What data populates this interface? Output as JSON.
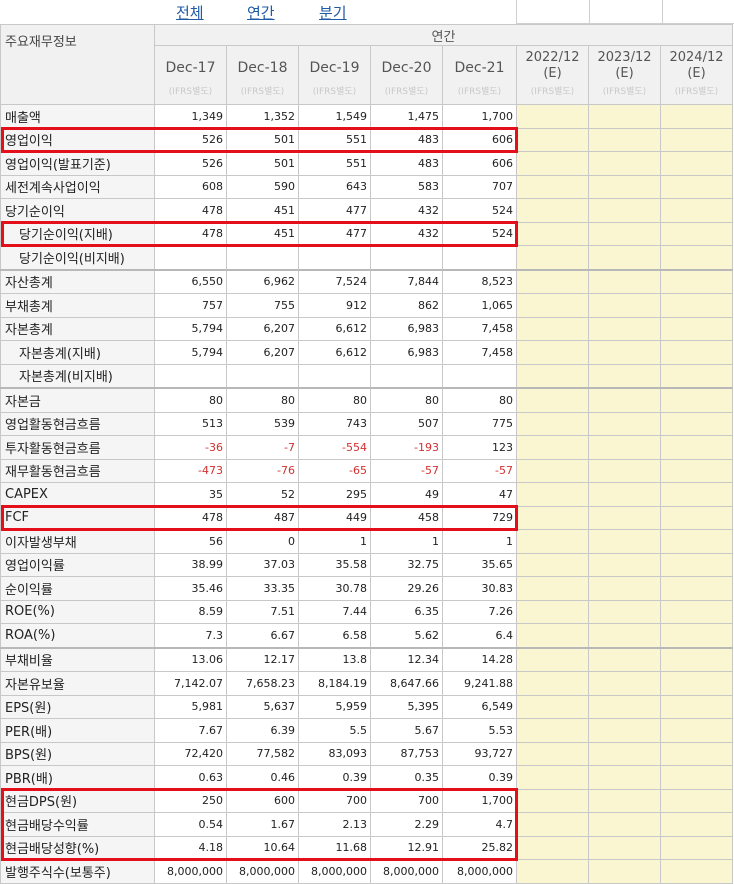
{
  "tabs": {
    "all": "전체",
    "annual": "연간",
    "quarter": "분기"
  },
  "header": {
    "label": "주요재무정보",
    "group": "연간",
    "periods": [
      "Dec-17",
      "Dec-18",
      "Dec-19",
      "Dec-20",
      "Dec-21"
    ],
    "estimates": [
      {
        "year": "2022/12",
        "tag": "(E)"
      },
      {
        "year": "2023/12",
        "tag": "(E)"
      },
      {
        "year": "2024/12",
        "tag": "(E)"
      }
    ],
    "ifrs": "(IFRS별도)"
  },
  "rows": [
    {
      "label": "매출액",
      "values": [
        "1,349",
        "1,352",
        "1,549",
        "1,475",
        "1,700"
      ]
    },
    {
      "label": "영업이익",
      "values": [
        "526",
        "501",
        "551",
        "483",
        "606"
      ]
    },
    {
      "label": "영업이익(발표기준)",
      "values": [
        "526",
        "501",
        "551",
        "483",
        "606"
      ]
    },
    {
      "label": "세전계속사업이익",
      "values": [
        "608",
        "590",
        "643",
        "583",
        "707"
      ]
    },
    {
      "label": "당기순이익",
      "values": [
        "478",
        "451",
        "477",
        "432",
        "524"
      ]
    },
    {
      "label": "당기순이익(지배)",
      "indent": true,
      "values": [
        "478",
        "451",
        "477",
        "432",
        "524"
      ]
    },
    {
      "label": "당기순이익(비지배)",
      "indent": true,
      "values": [
        "",
        "",
        "",
        "",
        ""
      ]
    },
    {
      "label": "자산총계",
      "values": [
        "6,550",
        "6,962",
        "7,524",
        "7,844",
        "8,523"
      ]
    },
    {
      "label": "부채총계",
      "values": [
        "757",
        "755",
        "912",
        "862",
        "1,065"
      ]
    },
    {
      "label": "자본총계",
      "values": [
        "5,794",
        "6,207",
        "6,612",
        "6,983",
        "7,458"
      ]
    },
    {
      "label": "자본총계(지배)",
      "indent": true,
      "values": [
        "5,794",
        "6,207",
        "6,612",
        "6,983",
        "7,458"
      ]
    },
    {
      "label": "자본총계(비지배)",
      "indent": true,
      "values": [
        "",
        "",
        "",
        "",
        ""
      ]
    },
    {
      "label": "자본금",
      "values": [
        "80",
        "80",
        "80",
        "80",
        "80"
      ]
    },
    {
      "label": "영업활동현금흐름",
      "values": [
        "513",
        "539",
        "743",
        "507",
        "775"
      ]
    },
    {
      "label": "투자활동현금흐름",
      "values": [
        "-36",
        "-7",
        "-554",
        "-193",
        "123"
      ]
    },
    {
      "label": "재무활동현금흐름",
      "values": [
        "-473",
        "-76",
        "-65",
        "-57",
        "-57"
      ]
    },
    {
      "label": "CAPEX",
      "values": [
        "35",
        "52",
        "295",
        "49",
        "47"
      ]
    },
    {
      "label": "FCF",
      "values": [
        "478",
        "487",
        "449",
        "458",
        "729"
      ]
    },
    {
      "label": "이자발생부채",
      "values": [
        "56",
        "0",
        "1",
        "1",
        "1"
      ]
    },
    {
      "label": "영업이익률",
      "values": [
        "38.99",
        "37.03",
        "35.58",
        "32.75",
        "35.65"
      ]
    },
    {
      "label": "순이익률",
      "values": [
        "35.46",
        "33.35",
        "30.78",
        "29.26",
        "30.83"
      ]
    },
    {
      "label": "ROE(%)",
      "values": [
        "8.59",
        "7.51",
        "7.44",
        "6.35",
        "7.26"
      ]
    },
    {
      "label": "ROA(%)",
      "values": [
        "7.3",
        "6.67",
        "6.58",
        "5.62",
        "6.4"
      ]
    },
    {
      "label": "부채비율",
      "values": [
        "13.06",
        "12.17",
        "13.8",
        "12.34",
        "14.28"
      ]
    },
    {
      "label": "자본유보율",
      "values": [
        "7,142.07",
        "7,658.23",
        "8,184.19",
        "8,647.66",
        "9,241.88"
      ]
    },
    {
      "label": "EPS(원)",
      "values": [
        "5,981",
        "5,637",
        "5,959",
        "5,395",
        "6,549"
      ]
    },
    {
      "label": "PER(배)",
      "values": [
        "7.67",
        "6.39",
        "5.5",
        "5.67",
        "5.53"
      ]
    },
    {
      "label": "BPS(원)",
      "values": [
        "72,420",
        "77,582",
        "83,093",
        "87,753",
        "93,727"
      ]
    },
    {
      "label": "PBR(배)",
      "values": [
        "0.63",
        "0.46",
        "0.39",
        "0.35",
        "0.39"
      ]
    },
    {
      "label": "현금DPS(원)",
      "values": [
        "250",
        "600",
        "700",
        "700",
        "1,700"
      ]
    },
    {
      "label": "현금배당수익률",
      "values": [
        "0.54",
        "1.67",
        "2.13",
        "2.29",
        "4.7"
      ]
    },
    {
      "label": "현금배당성향(%)",
      "values": [
        "4.18",
        "10.64",
        "11.68",
        "12.91",
        "25.82"
      ]
    },
    {
      "label": "발행주식수(보통주)",
      "values": [
        "8,000,000",
        "8,000,000",
        "8,000,000",
        "8,000,000",
        "8,000,000"
      ]
    }
  ],
  "colors": {
    "highlight": "#e3101c",
    "negative": "#d23030",
    "estimate_bg": "#fbf6d2",
    "tab_link": "#1f5aa6"
  }
}
